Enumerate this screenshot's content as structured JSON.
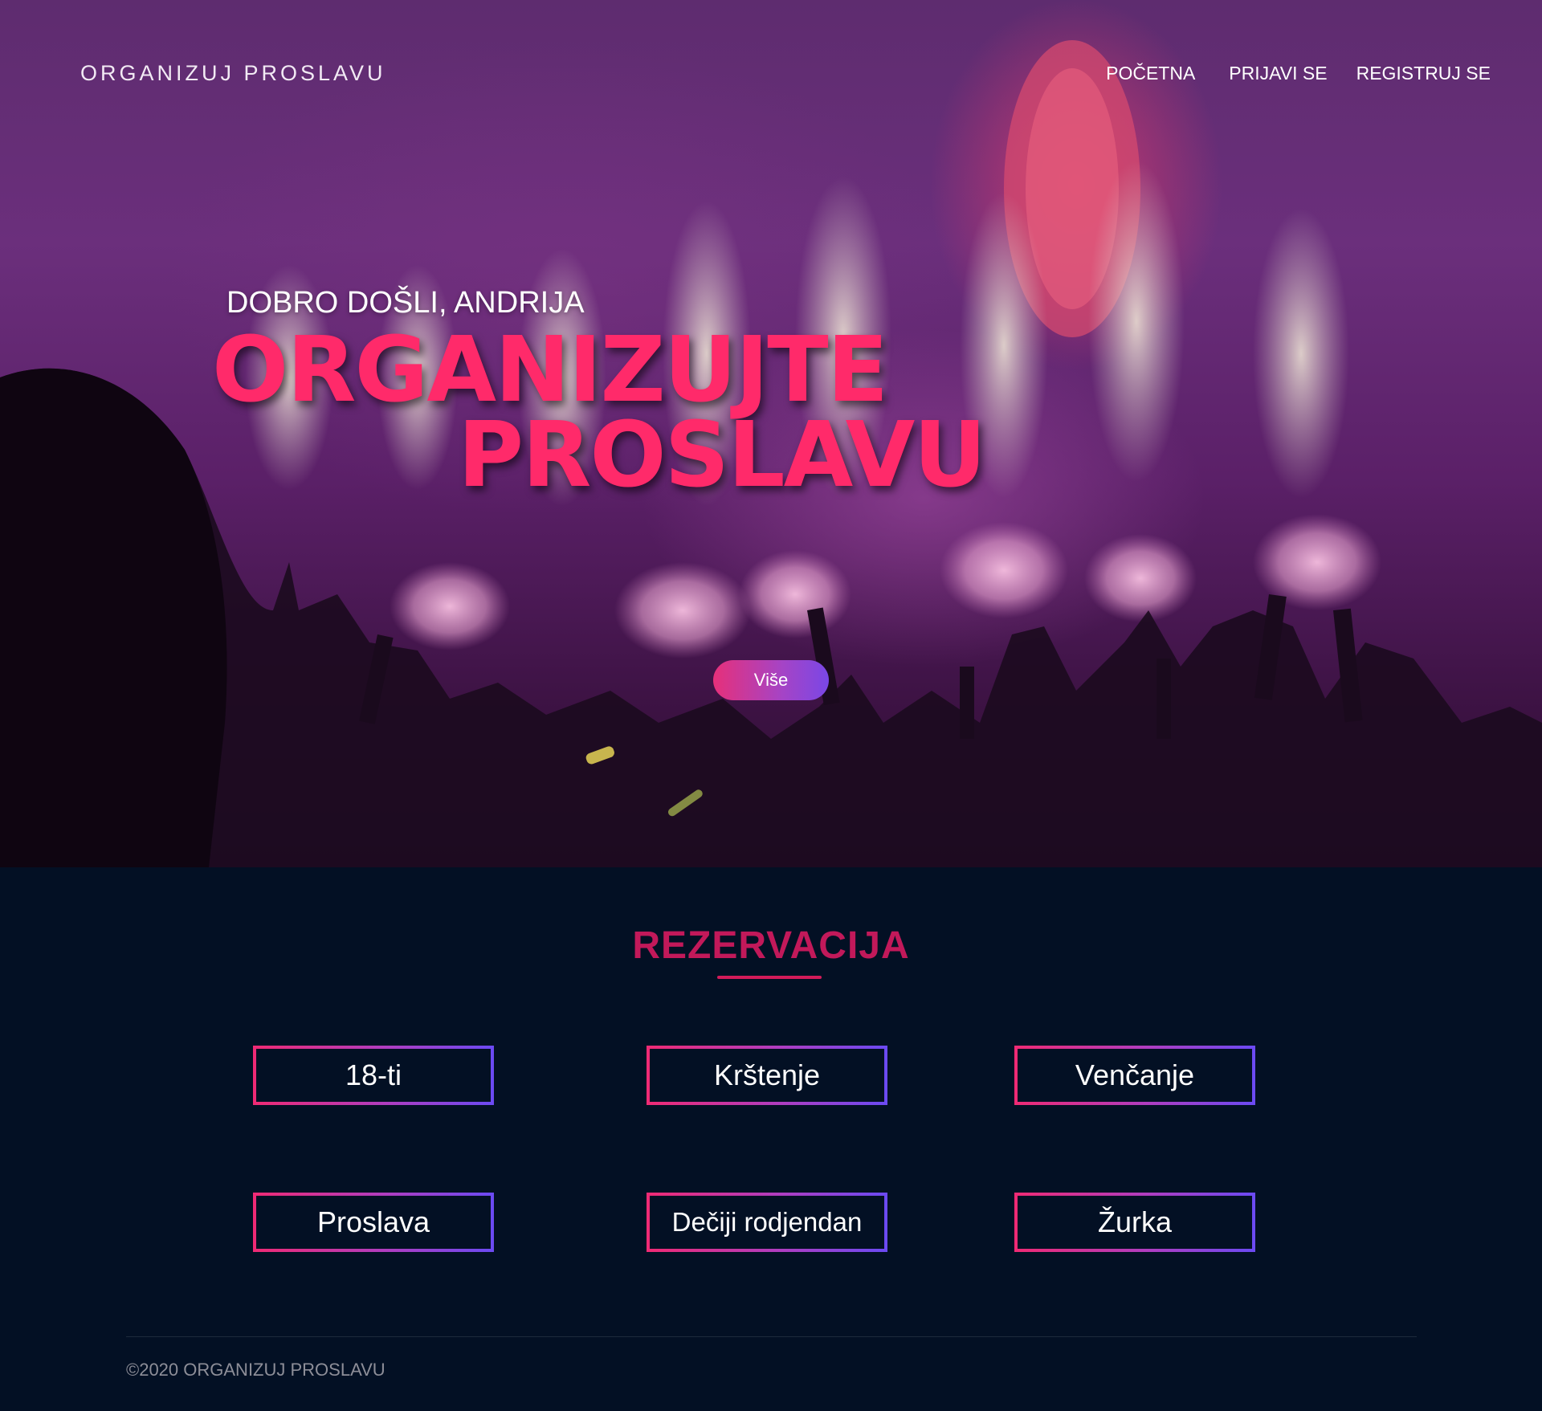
{
  "header": {
    "brand": "ORGANIZUJ PROSLAVU",
    "nav": [
      "POČETNA",
      "PRIJAVI SE",
      "REGISTRUJ SE"
    ]
  },
  "hero": {
    "welcome": "DOBRO DOŠLI, ANDRIJA",
    "headline_line1": "ORGANIZUJTE",
    "headline_line2": "PROSLAVU",
    "more_button": "Više"
  },
  "reservation": {
    "title": "REZERVACIJA",
    "options": [
      "18-ti",
      "Krštenje",
      "Venčanje",
      "Proslava",
      "Dečiji rodjendan",
      "Žurka"
    ]
  },
  "footer": {
    "copyright": "©2020 ORGANIZUJ PROSLAVU"
  },
  "colors": {
    "accent": "#ff2a6a",
    "title": "#c2195a",
    "background": "#031024",
    "gradient_start": "#f02a74",
    "gradient_end": "#6b4af3"
  }
}
